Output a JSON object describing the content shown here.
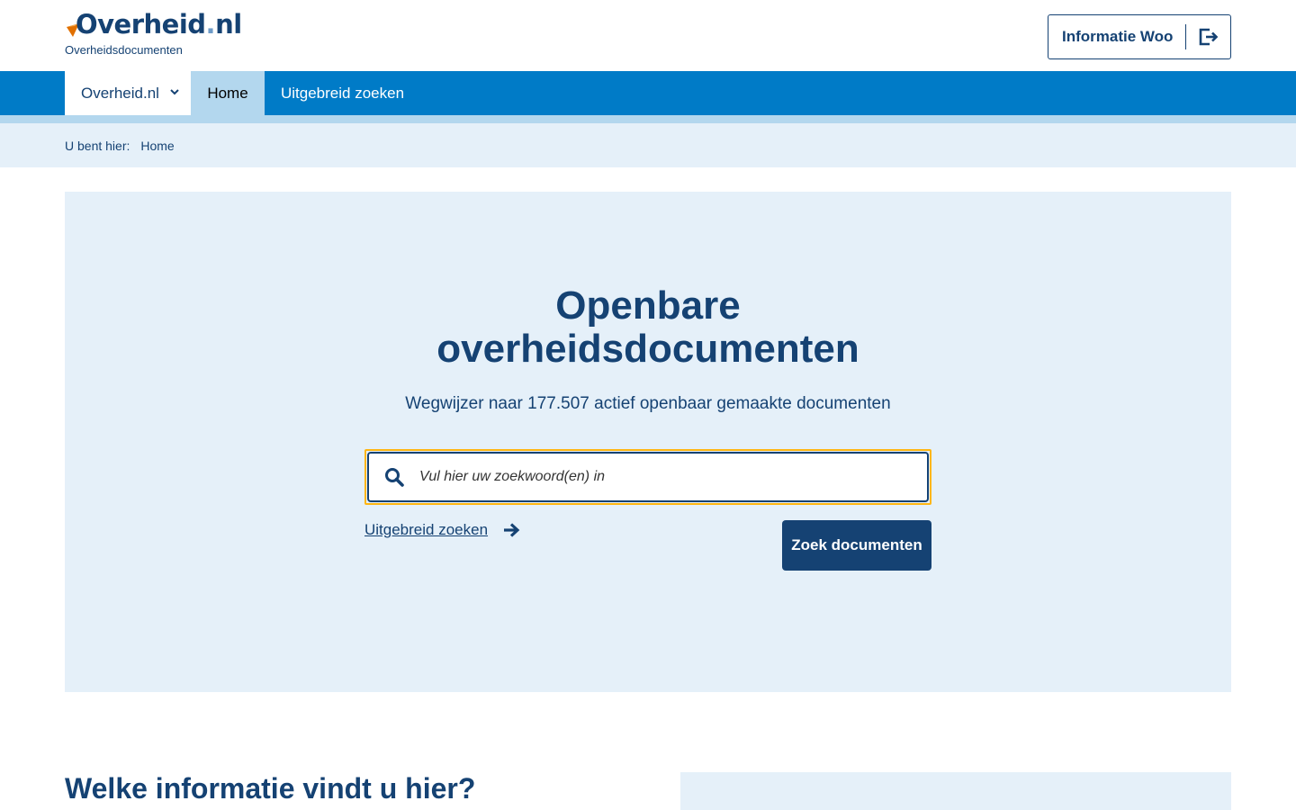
{
  "header": {
    "logo_main": "Overheid",
    "logo_dot": ".",
    "logo_tld": "nl",
    "logo_sub": "Overheidsdocumenten",
    "info_button_label": "Informatie Woo"
  },
  "nav": {
    "dropdown_label": "Overheid.nl",
    "items": [
      {
        "label": "Home",
        "active": true
      },
      {
        "label": "Uitgebreid zoeken",
        "active": false
      }
    ]
  },
  "breadcrumb": {
    "prefix": "U bent hier:",
    "items": [
      "Home"
    ]
  },
  "hero": {
    "title_line1": "Openbare",
    "title_line2": "overheidsdocumenten",
    "subtitle": "Wegwijzer naar 177.507 actief openbaar gemaakte documenten",
    "search_placeholder": "Vul hier uw zoekwoord(en) in",
    "advanced_link": "Uitgebreid zoeken",
    "search_button": "Zoek documenten"
  },
  "content": {
    "section_title": "Welke informatie vindt u hier?"
  },
  "colors": {
    "primary_dark": "#154273",
    "nav_blue": "#007bc7",
    "light_blue": "#e5f0f9",
    "active_blue": "#b3d7ee",
    "focus_yellow": "#ffb612",
    "logo_orange": "#e17000"
  },
  "icons": {
    "logo": "overheid-swoosh-icon",
    "info_button": "logout-arrow-icon",
    "dropdown": "chevron-down-icon",
    "search": "search-icon",
    "advanced": "arrow-right-icon"
  }
}
